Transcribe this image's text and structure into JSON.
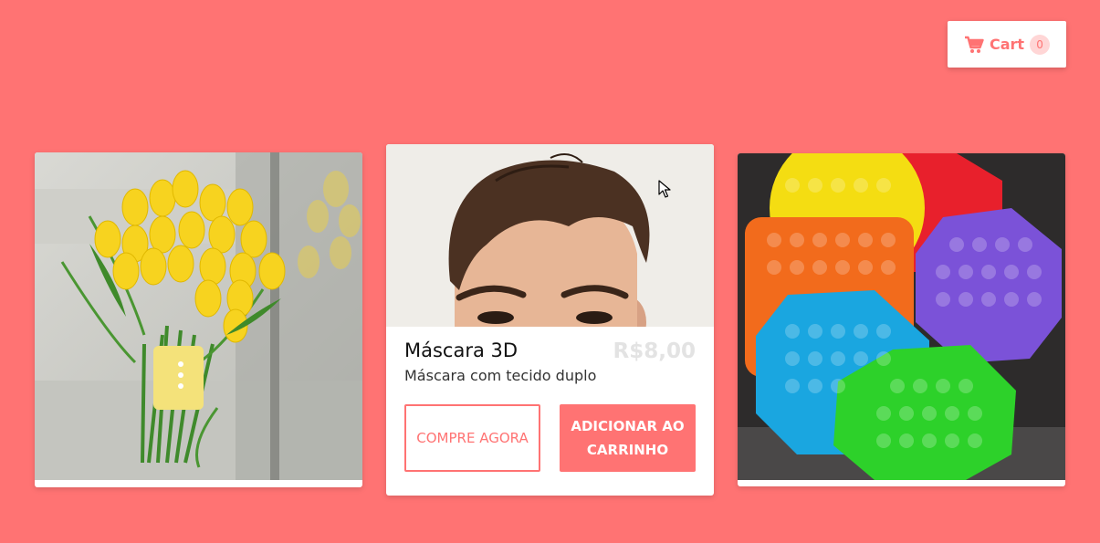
{
  "cart": {
    "label": "Cart",
    "count": "0",
    "icon": "shopping-cart-icon"
  },
  "products": [
    {
      "image": "yellow-tulip-bouquet"
    },
    {
      "image": "young-man-face-photo",
      "title": "Máscara 3D",
      "price": "R$8,00",
      "description": "Máscara com tecido duplo",
      "buy_label": "COMPRE AGORA",
      "add_label": "ADICIONAR AO CARRINHO"
    },
    {
      "image": "colorful-pop-it-toys"
    }
  ],
  "colors": {
    "background": "#ff7373",
    "accent": "#ff7373",
    "price_text": "#e3e3e3"
  }
}
